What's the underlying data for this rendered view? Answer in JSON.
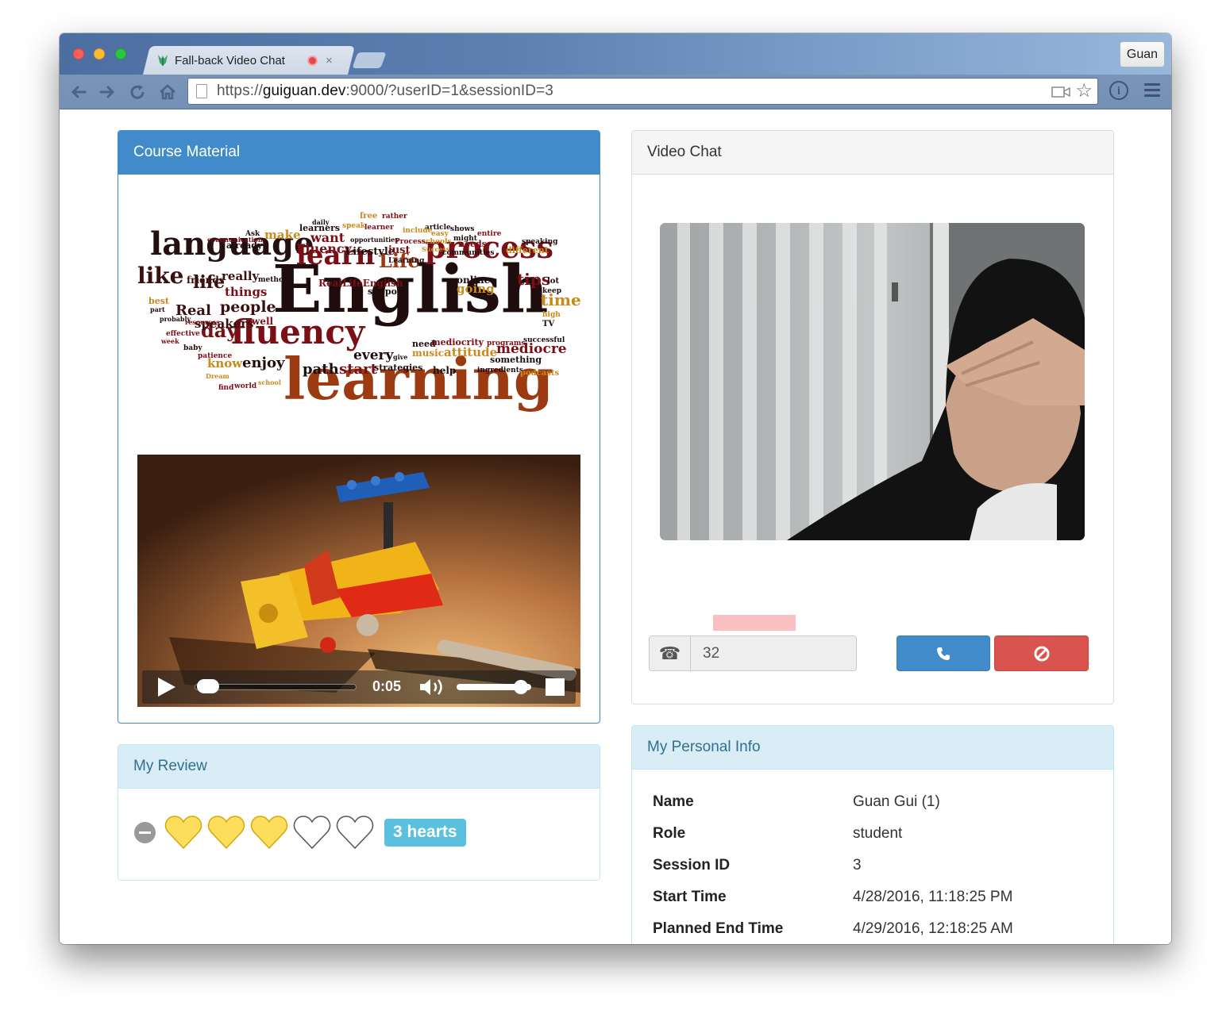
{
  "browser": {
    "tab_title": "Fall-back Video Chat",
    "tab_close": "×",
    "profile_name": "Guan",
    "url_scheme": "https://",
    "url_host": "guiguan.dev",
    "url_rest": ":9000/?userID=1&sessionID=3"
  },
  "course_material": {
    "heading": "Course Material",
    "video": {
      "time": "0:05",
      "progress": 0.03,
      "volume": 0.85
    }
  },
  "video_chat": {
    "heading": "Video Chat",
    "phone_input_value": "32"
  },
  "review": {
    "heading": "My Review",
    "hearts_filled": 3,
    "hearts_total": 5,
    "badge": "3 hearts",
    "heart_color": "#fddd5c"
  },
  "personal_info": {
    "heading": "My Personal Info",
    "rows": [
      {
        "label": "Name",
        "value": "Guan Gui (1)"
      },
      {
        "label": "Role",
        "value": "student"
      },
      {
        "label": "Session ID",
        "value": "3"
      },
      {
        "label": "Start Time",
        "value": "4/28/2016, 11:18:25 PM"
      },
      {
        "label": "Planned End Time",
        "value": "4/29/2016, 12:18:25 AM"
      }
    ]
  },
  "wordcloud_words": {
    "main": [
      "English",
      "learning",
      "language",
      "fluency",
      "process",
      "learn",
      "Life",
      "like",
      "life",
      "time",
      "tips",
      "day",
      "people",
      "Real",
      "enjoy",
      "know",
      "path",
      "start",
      "every",
      "mediocre",
      "attitude",
      "music",
      "speakers",
      "things",
      "really",
      "friends",
      "make",
      "want",
      "Fluency",
      "Lifestyle",
      "just",
      "going",
      "online",
      "support",
      "RealLifeEnglish",
      "need",
      "mediocrity",
      "programs",
      "successful",
      "help",
      "strategies",
      "ingredients",
      "podcasts",
      "something",
      "different",
      "speaking",
      "needs",
      "schools",
      "Success",
      "article",
      "include",
      "easy",
      "learners",
      "learner",
      "speak",
      "free",
      "rather",
      "daily",
      "Ask",
      "already",
      "communication",
      "opportunities",
      "Process",
      "shows",
      "entire",
      "might",
      "communities",
      "Learning",
      "methods",
      "best",
      "probably",
      "part",
      "well",
      "resources",
      "effective",
      "week",
      "baby",
      "patience",
      "Dream",
      "find",
      "world",
      "school",
      "give",
      "high",
      "TV",
      "keep",
      "lot"
    ]
  },
  "colors": {
    "primary": "#428bca",
    "danger": "#d9534f",
    "info_bg": "#d9edf7",
    "info_text": "#31708f",
    "badge": "#5bc0de"
  }
}
